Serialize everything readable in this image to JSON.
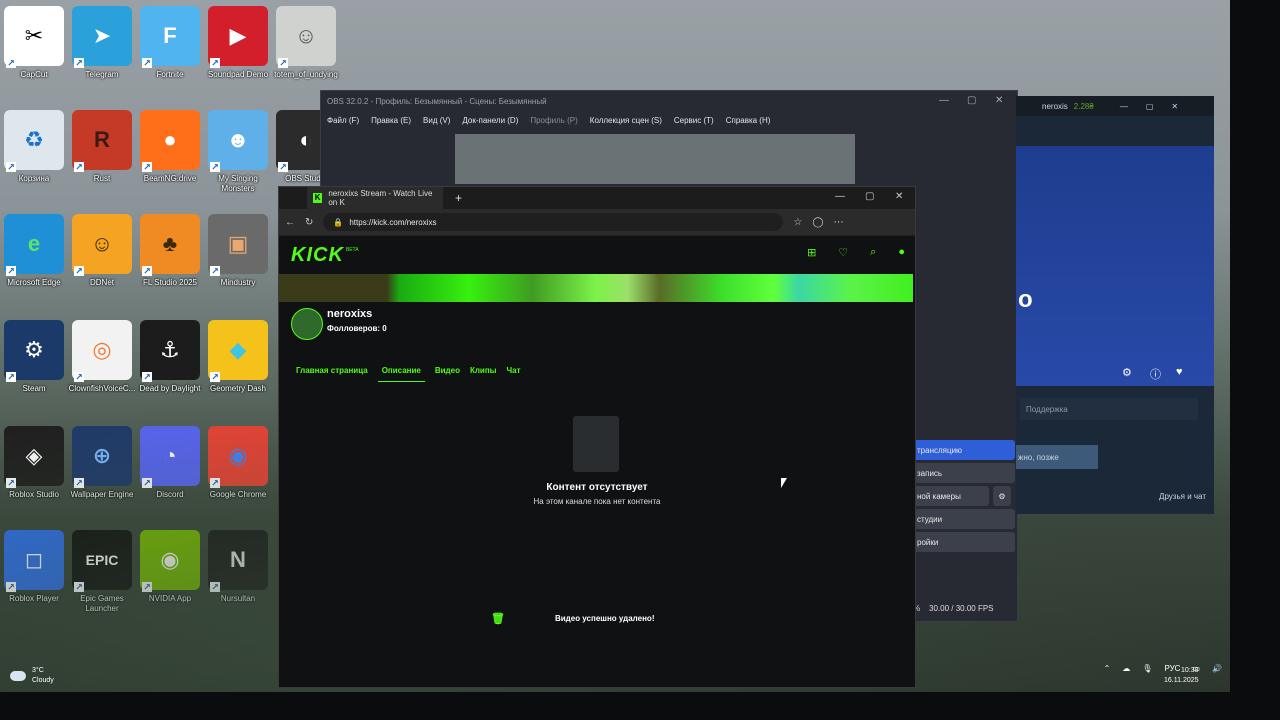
{
  "desktop": {
    "icons": [
      {
        "label": "CapCut",
        "glyph": "✂",
        "bg": "#ffffff",
        "fg": "#000000"
      },
      {
        "label": "Telegram",
        "glyph": "➤",
        "bg": "#2aa1da",
        "fg": "#ffffff"
      },
      {
        "label": "Fortnite",
        "glyph": "F",
        "bg": "#4fb4f0",
        "fg": "#ffffff"
      },
      {
        "label": "Soundpad Demo",
        "glyph": "▶",
        "bg": "#d31f2b",
        "fg": "#ffffff"
      },
      {
        "label": "totem_of_undying",
        "glyph": "☺",
        "bg": "#cfd2cf",
        "fg": "#555555"
      },
      {
        "label": "Корзина",
        "glyph": "♻",
        "bg": "#dfe7ee",
        "fg": "#1a73c7"
      },
      {
        "label": "Rust",
        "glyph": "R",
        "bg": "#c53a27",
        "fg": "#3a1a12"
      },
      {
        "label": "BeamNG.drive",
        "glyph": "●",
        "bg": "#ff6f1a",
        "fg": "#ffffff"
      },
      {
        "label": "My Singing Monsters",
        "glyph": "☻",
        "bg": "#5fb0e8",
        "fg": "#ffffff"
      },
      {
        "label": "Microsoft Edge",
        "glyph": "e",
        "bg": "#1f8fd6",
        "fg": "#5ee26a"
      },
      {
        "label": "DDNet",
        "glyph": "☺",
        "bg": "#f4a422",
        "fg": "#3a2a08"
      },
      {
        "label": "FL Studio 2025",
        "glyph": "♣",
        "bg": "#f08a22",
        "fg": "#3a2a08"
      },
      {
        "label": "Mindustry",
        "glyph": "▣",
        "bg": "#6a6a6a",
        "fg": "#e8a870"
      },
      {
        "label": "Steam",
        "glyph": "⚙",
        "bg": "#1b3a6a",
        "fg": "#ffffff"
      },
      {
        "label": "ClownfishVoiceC...",
        "glyph": "◎",
        "bg": "#f2f2f2",
        "fg": "#f07a32"
      },
      {
        "label": "Dead by Daylight",
        "glyph": "⚓",
        "bg": "#1c1c1c",
        "fg": "#ffffff"
      },
      {
        "label": "Geometry Dash",
        "glyph": "◆",
        "bg": "#f4c21a",
        "fg": "#3fc4e6"
      },
      {
        "label": "Roblox Studio",
        "glyph": "◈",
        "bg": "#1f1f1f",
        "fg": "#ffffff"
      },
      {
        "label": "Wallpaper Engine",
        "glyph": "⊕",
        "bg": "#1f3a6a",
        "fg": "#7ab8ff"
      },
      {
        "label": "Discord",
        "glyph": "◔",
        "bg": "#5865f2",
        "fg": "#ffffff"
      },
      {
        "label": "Google Chrome",
        "glyph": "◉",
        "bg": "#e94335",
        "fg": "#4285f4"
      },
      {
        "label": "Roblox Player",
        "glyph": "◻",
        "bg": "#2d6ee8",
        "fg": "#ffffff"
      },
      {
        "label": "Epic Games Launcher",
        "glyph": "EPIC",
        "bg": "#111111",
        "fg": "#ffffff"
      },
      {
        "label": "NVIDIA App",
        "glyph": "◉",
        "bg": "#76b900",
        "fg": "#ffffff"
      },
      {
        "label": "Nursultan",
        "glyph": "N",
        "bg": "#1b1b1b",
        "fg": "#e8e8e8"
      },
      {
        "label": "OBS Studio",
        "glyph": "◐",
        "bg": "#2b2b2b",
        "fg": "#ffffff"
      }
    ]
  },
  "obs": {
    "title": "OBS 32.0.2 - Профиль: Безымянный - Сцены: Безымянный",
    "menu": [
      "Файл (F)",
      "Правка (E)",
      "Вид (V)",
      "Док-панели (D)",
      "Профиль (P)",
      "Коллекция сцен (S)",
      "Сервис (T)",
      "Справка (H)"
    ],
    "controls": [
      "трансляцию",
      "запись",
      "ной камеры",
      "студии",
      "ройки"
    ],
    "status": "30.00 / 30.00 FPS",
    "status_prefix": "%"
  },
  "steam": {
    "user": "neroxis",
    "balance": "2.28₴",
    "hero_text": "o",
    "support": "Поддержка",
    "later": "жно, позже",
    "friends": "Друзья и чат"
  },
  "browser": {
    "tab_title": "neroxixs Stream - Watch Live on K",
    "url": "https://kick.com/neroxixs"
  },
  "kick": {
    "logo": "KICK",
    "logo_badge": "BETA",
    "channel_name": "neroxixs",
    "followers": "Фолловеров: 0",
    "nav": [
      "Главная страница",
      "Описание",
      "Видео",
      "Клипы",
      "Чат"
    ],
    "active_tab": "Описание",
    "empty_title": "Контент отсутствует",
    "empty_subtitle": "На этом канале пока нет контента",
    "toast": "Видео успешно удалено!",
    "accent": "#53fc18"
  },
  "taskbar": {
    "temperature": "3°C",
    "weather": "Cloudy",
    "language": "РУС",
    "time": "10:38",
    "date": "16.11.2025"
  }
}
